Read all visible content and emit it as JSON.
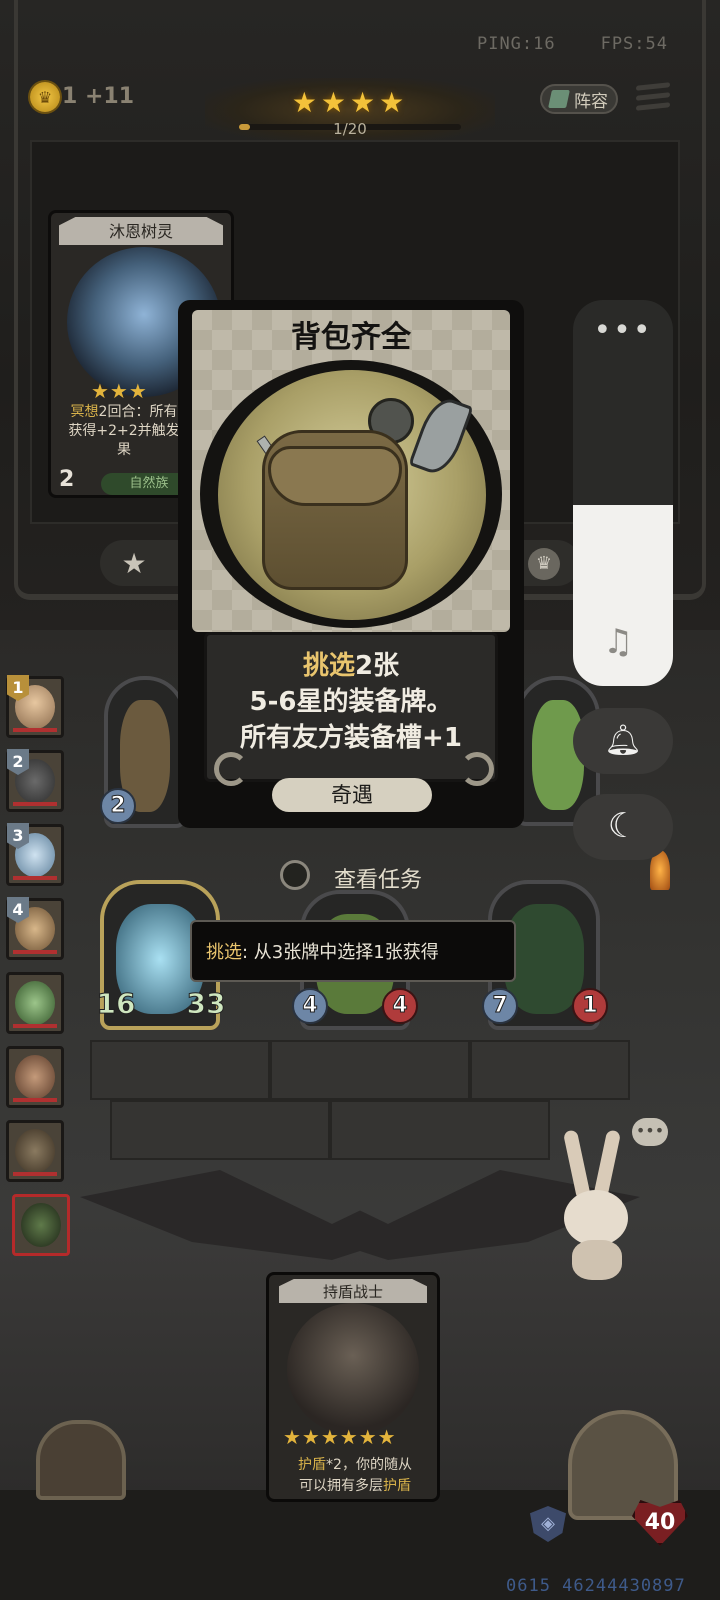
{
  "status": {
    "ping": "PING:16",
    "fps": "FPS:54"
  },
  "economy": {
    "coin_text": "1 +11"
  },
  "progress": {
    "stars": "★★★★",
    "text": "1/20",
    "fraction": 0.05
  },
  "header": {
    "lineup_label": "阵容"
  },
  "shop_card": {
    "name": "沐恩树灵",
    "stars": "★★★",
    "desc_hl": "冥想",
    "desc_rest1": "2回合：所有",
    "desc_rest2": "获得+2+2并触发",
    "desc_rest3": "果",
    "tier": "2",
    "tribe": "自然族"
  },
  "event_card": {
    "title": "背包齐全",
    "line1_hl": "挑选",
    "line1_rest": "2张",
    "line2": "5-6星的装备牌。",
    "line3": "所有友方装备槽+1",
    "tag": "奇遇"
  },
  "quest": {
    "label": "查看任务"
  },
  "tooltip": {
    "hl": "挑选",
    "rest": ": 从3张牌中选择1张获得"
  },
  "sidebar": {
    "players": [
      {
        "rank": "1",
        "rank_color": "#b8903a"
      },
      {
        "rank": "2",
        "rank_color": "#6b7a88"
      },
      {
        "rank": "3",
        "rank_color": "#6b7a88"
      },
      {
        "rank": "4",
        "rank_color": "#6b7a88"
      },
      {
        "rank": "",
        "rank_color": ""
      },
      {
        "rank": "",
        "rank_color": ""
      },
      {
        "rank": "",
        "rank_color": ""
      },
      {
        "rank": "",
        "rank_color": ""
      }
    ]
  },
  "board": {
    "minion1": {
      "atk": "2"
    },
    "minion_ghost": {
      "atk": "16",
      "hp": "33"
    },
    "minion_cactus": {
      "atk": "4",
      "hp": "4"
    },
    "minion_tentacle": {
      "atk": "7",
      "hp": "1"
    }
  },
  "hero_card": {
    "name": "持盾战士",
    "stars": "★★★★★★",
    "desc_hl": "护盾",
    "desc_rest1": "*2，你的随从",
    "desc_rest2": "可以拥有多层",
    "desc_hl2": "护盾"
  },
  "player": {
    "hp": "40"
  },
  "serial": "0615 46244430897",
  "system_overlay": {
    "more": "•••",
    "music_icon": "music-note",
    "bell_icon": "bell",
    "moon_icon": "moon",
    "volume_level": 0.47
  }
}
